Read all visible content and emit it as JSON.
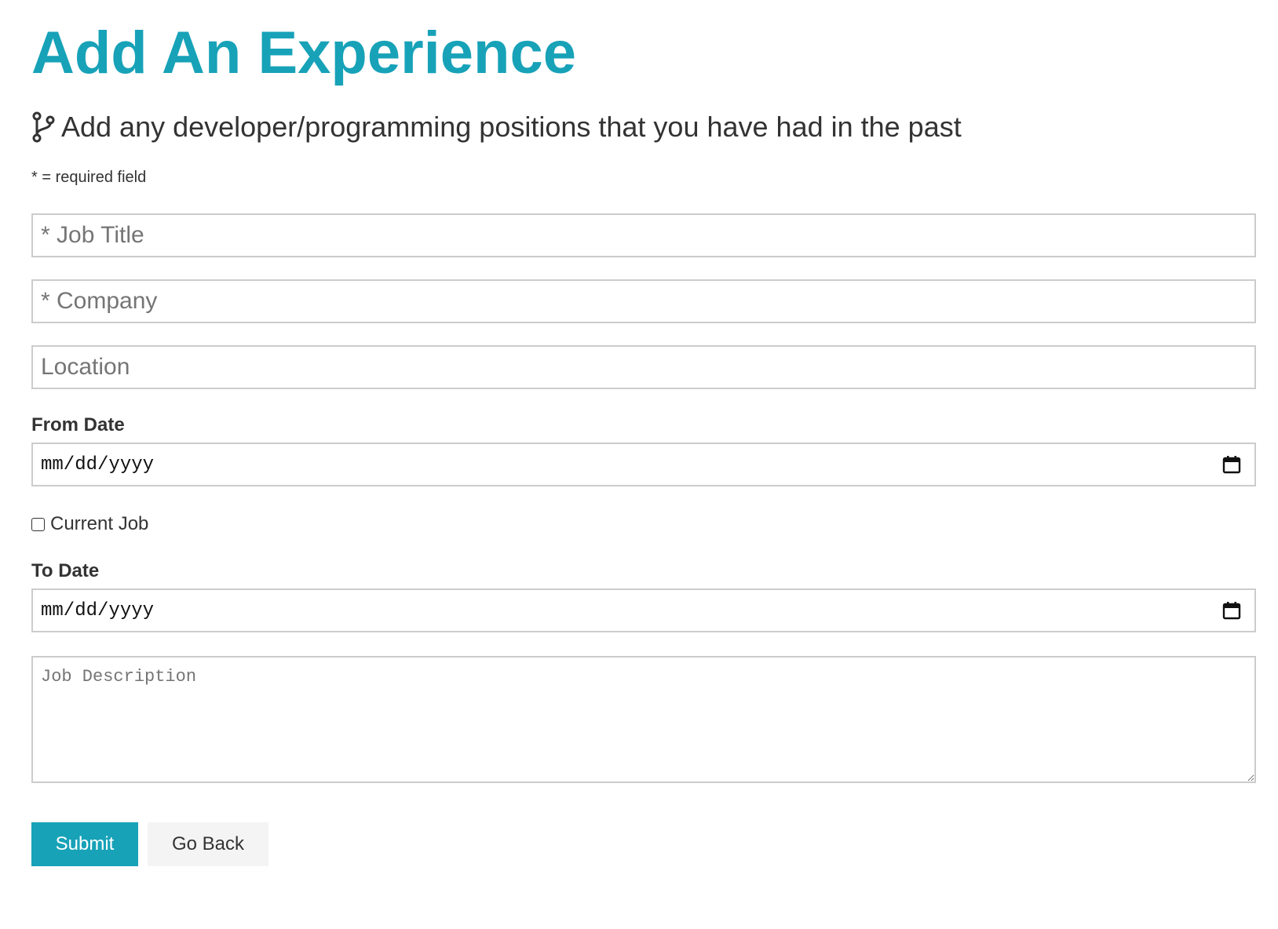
{
  "page": {
    "title": "Add An Experience",
    "lead": "Add any developer/programming positions that you have had in the past",
    "lead_icon": "code-branch-icon",
    "required_note": "* = required field",
    "accent_color": "#17a2b8"
  },
  "form": {
    "job_title": {
      "placeholder": "* Job Title",
      "value": ""
    },
    "company": {
      "placeholder": "* Company",
      "value": ""
    },
    "location": {
      "placeholder": "Location",
      "value": ""
    },
    "from_date": {
      "label": "From Date",
      "value": "mm/dd/yyyy"
    },
    "current_job": {
      "label": "Current Job",
      "checked": false
    },
    "to_date": {
      "label": "To Date",
      "value": "mm/dd/yyyy"
    },
    "description": {
      "placeholder": "Job Description",
      "value": ""
    }
  },
  "actions": {
    "submit_label": "Submit",
    "back_label": "Go Back"
  }
}
